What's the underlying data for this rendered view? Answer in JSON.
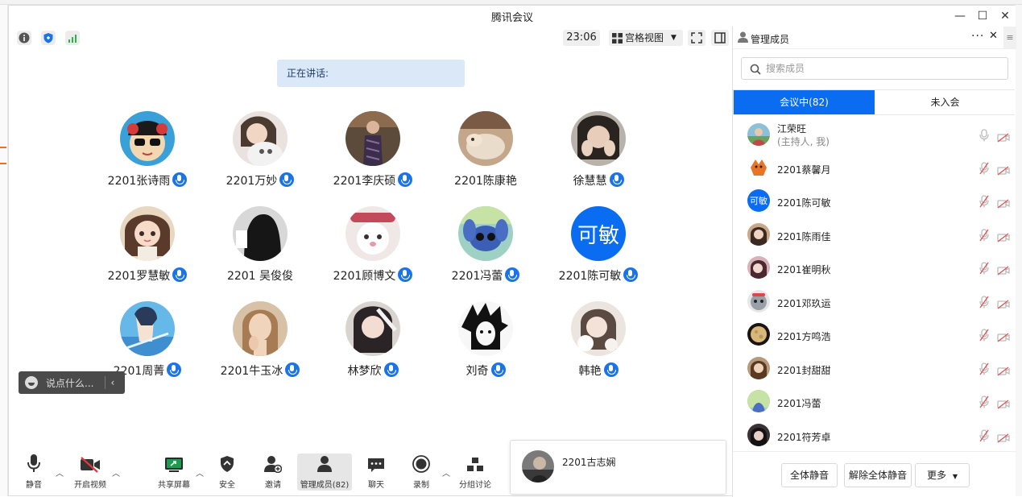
{
  "window": {
    "title": "腾讯会议"
  },
  "toolbar": {
    "timer": "23:06",
    "view_mode": "宫格视图"
  },
  "speaking": {
    "label": "正在讲话:"
  },
  "participants": [
    {
      "name": "2201张诗雨",
      "mic": true,
      "avatar": "photo-cartoon-sunglasses"
    },
    {
      "name": "2201万妙",
      "mic": true,
      "avatar": "photo-girl-cat"
    },
    {
      "name": "2201李庆硕",
      "mic": true,
      "avatar": "photo-person-room"
    },
    {
      "name": "2201陈康艳",
      "mic": false,
      "avatar": "photo-kitten"
    },
    {
      "name": "徐慧慧",
      "mic": true,
      "avatar": "photo-girl-hands"
    },
    {
      "name": "2201罗慧敏",
      "mic": true,
      "avatar": "photo-anime-girl"
    },
    {
      "name": "2201 吴俊俊",
      "mic": false,
      "avatar": "photo-dark-figure"
    },
    {
      "name": "2201顾博文",
      "mic": true,
      "avatar": "photo-white-cat"
    },
    {
      "name": "2201冯蕾",
      "mic": true,
      "avatar": "photo-stitch"
    },
    {
      "name": "2201陈可敏",
      "mic": true,
      "avatar_text": "可敏"
    },
    {
      "name": "2201周菁",
      "mic": true,
      "avatar": "photo-anime-sky"
    },
    {
      "name": "2201牛玉冰",
      "mic": true,
      "avatar": "photo-woman-portrait"
    },
    {
      "name": "林梦欣",
      "mic": true,
      "avatar": "photo-girl-dark-hair"
    },
    {
      "name": "刘奇",
      "mic": true,
      "avatar": "photo-manga-sketch"
    },
    {
      "name": "韩艳",
      "mic": true,
      "avatar": "photo-girl-flower"
    }
  ],
  "chat": {
    "placeholder": "说点什么..."
  },
  "bottom_toolbar": {
    "mute": "静音",
    "video": "开启视频",
    "share": "共享屏幕",
    "security": "安全",
    "invite": "邀请",
    "members": "管理成员(82)",
    "chat": "聊天",
    "record": "录制",
    "breakout": "分组讨论"
  },
  "self_view": {
    "name": "2201古志娴"
  },
  "panel": {
    "title": "管理成员",
    "search_placeholder": "搜索成员",
    "tab_in": "会议中(82)",
    "tab_out": "未入会",
    "members": [
      {
        "name": "江荣旺",
        "sub": "(主持人, 我)",
        "mic_muted": false,
        "avatar": "photo-host"
      },
      {
        "name": "2201蔡馨月",
        "mic_muted": true,
        "avatar": "photo-fox-cartoon"
      },
      {
        "name": "2201陈可敏",
        "mic_muted": true,
        "avatar_text": "可敏"
      },
      {
        "name": "2201陈雨佳",
        "mic_muted": true,
        "avatar": "photo-girl"
      },
      {
        "name": "2201崔明秋",
        "mic_muted": true,
        "avatar": "photo-girl-pink"
      },
      {
        "name": "2201邓玖运",
        "mic_muted": true,
        "avatar": "photo-cartoon-grey"
      },
      {
        "name": "2201方鸣浩",
        "mic_muted": true,
        "avatar": "photo-moon"
      },
      {
        "name": "2201封甜甜",
        "mic_muted": true,
        "avatar": "photo-girl-brown"
      },
      {
        "name": "2201冯蕾",
        "mic_muted": true,
        "avatar": "photo-stitch"
      },
      {
        "name": "2201符芳卓",
        "mic_muted": true,
        "avatar": "photo-girl-dark"
      }
    ],
    "mute_all": "全体静音",
    "unmute_all": "解除全体静音",
    "more": "更多"
  },
  "colors": {
    "accent": "#0a6cf1",
    "mic_badge": "#1a73e8",
    "speaking_bg": "#dbe8f8"
  }
}
